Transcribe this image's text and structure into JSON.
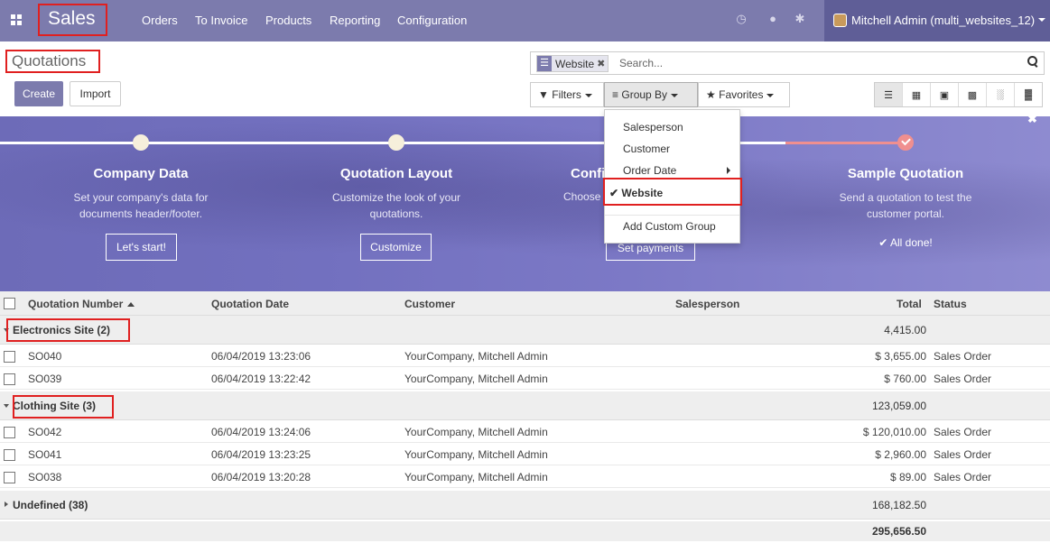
{
  "navbar": {
    "brand": "Sales",
    "menu": [
      "Orders",
      "To Invoice",
      "Products",
      "Reporting",
      "Configuration"
    ],
    "user": "Mitchell Admin (multi_websites_12)"
  },
  "control_panel": {
    "title": "Quotations",
    "create_label": "Create",
    "import_label": "Import",
    "search": {
      "facet": "Website",
      "placeholder": "Search..."
    },
    "filters_label": "Filters",
    "groupby_label": "Group By",
    "favorites_label": "Favorites"
  },
  "groupby_menu": {
    "items": [
      "Salesperson",
      "Customer",
      "Order Date",
      "Website"
    ],
    "checked": "Website",
    "custom": "Add Custom Group"
  },
  "banner": {
    "steps": [
      {
        "title": "Company Data",
        "desc1": "Set your company's data for",
        "desc2": "documents header/footer.",
        "button": "Let's start!"
      },
      {
        "title": "Quotation Layout",
        "desc1": "Customize the look of your",
        "desc2": "quotations.",
        "button": "Customize"
      },
      {
        "title": "Confi",
        "desc1": "Choose",
        "desc2": "",
        "button": "Set payments"
      },
      {
        "title": "Sample Quotation",
        "desc1": "Send a quotation to test the",
        "desc2": "customer portal.",
        "done": "All done!"
      }
    ]
  },
  "table": {
    "columns": [
      "Quotation Number",
      "Quotation Date",
      "Customer",
      "Salesperson",
      "Total",
      "Status"
    ],
    "groups": [
      {
        "title": "Electronics Site (2)",
        "total": "4,415.00",
        "rows": [
          {
            "number": "SO040",
            "date": "06/04/2019 13:23:06",
            "customer": "YourCompany, Mitchell Admin",
            "total": "$ 3,655.00",
            "status": "Sales Order"
          },
          {
            "number": "SO039",
            "date": "06/04/2019 13:22:42",
            "customer": "YourCompany, Mitchell Admin",
            "total": "$ 760.00",
            "status": "Sales Order"
          }
        ]
      },
      {
        "title": "Clothing Site (3)",
        "total": "123,059.00",
        "rows": [
          {
            "number": "SO042",
            "date": "06/04/2019 13:24:06",
            "customer": "YourCompany, Mitchell Admin",
            "total": "$ 120,010.00",
            "status": "Sales Order"
          },
          {
            "number": "SO041",
            "date": "06/04/2019 13:23:25",
            "customer": "YourCompany, Mitchell Admin",
            "total": "$ 2,960.00",
            "status": "Sales Order"
          },
          {
            "number": "SO038",
            "date": "06/04/2019 13:20:28",
            "customer": "YourCompany, Mitchell Admin",
            "total": "$ 89.00",
            "status": "Sales Order"
          }
        ]
      },
      {
        "title": "Undefined (38)",
        "total": "168,182.50"
      }
    ],
    "grand_total": "295,656.50"
  }
}
